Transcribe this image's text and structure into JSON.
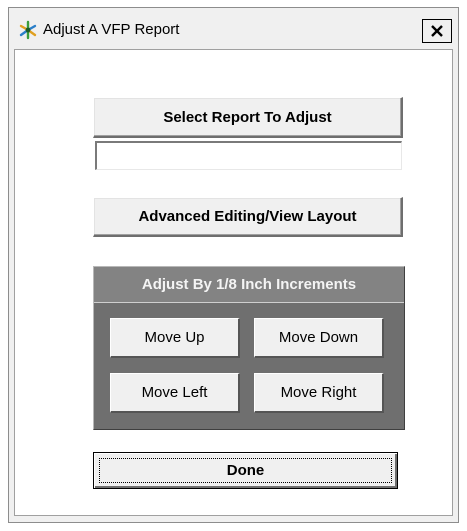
{
  "window": {
    "title": "Adjust A VFP Report",
    "icon": "vfp-app-icon",
    "close_label": "X"
  },
  "main": {
    "select_report_label": "Select Report To Adjust",
    "report_field_value": "",
    "advanced_editing_label": "Advanced Editing/View Layout",
    "done_label": "Done"
  },
  "adjust_group": {
    "header": "Adjust By 1/8 Inch Increments",
    "move_up_label": "Move Up",
    "move_down_label": "Move Down",
    "move_left_label": "Move Left",
    "move_right_label": "Move Right"
  }
}
